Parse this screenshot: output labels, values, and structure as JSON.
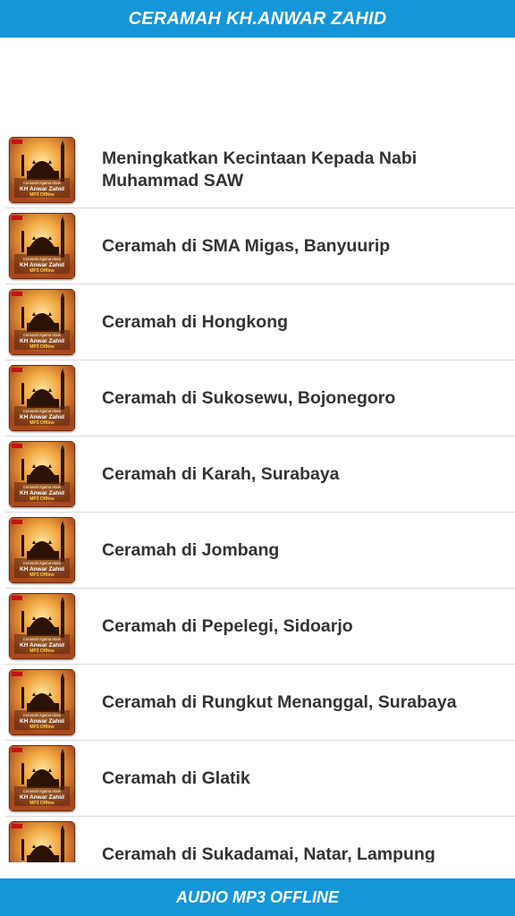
{
  "header": {
    "title": "CERAMAH KH.ANWAR ZAHID"
  },
  "items": [
    {
      "title": "Meningkatkan Kecintaan Kepada Nabi Muhammad SAW"
    },
    {
      "title": "Ceramah di SMA Migas, Banyuurip"
    },
    {
      "title": "Ceramah di Hongkong"
    },
    {
      "title": "Ceramah di Sukosewu, Bojonegoro"
    },
    {
      "title": "Ceramah di Karah, Surabaya"
    },
    {
      "title": "Ceramah di Jombang"
    },
    {
      "title": "Ceramah di Pepelegi, Sidoarjo"
    },
    {
      "title": "Ceramah di Rungkut Menanggal, Surabaya"
    },
    {
      "title": "Ceramah di Glatik"
    },
    {
      "title": "Ceramah di Sukadamai, Natar, Lampung"
    }
  ],
  "thumbnail": {
    "icon": "mosque-app-icon",
    "text_line1": "Ceramah Agama Islam",
    "text_line2": "KH Anwar Zahid",
    "text_line3": "MP3 Offline"
  },
  "footer": {
    "label": "AUDIO MP3 OFFLINE"
  },
  "colors": {
    "bar": "#1596d9",
    "text": "#333333",
    "divider": "#d9d9d9"
  }
}
